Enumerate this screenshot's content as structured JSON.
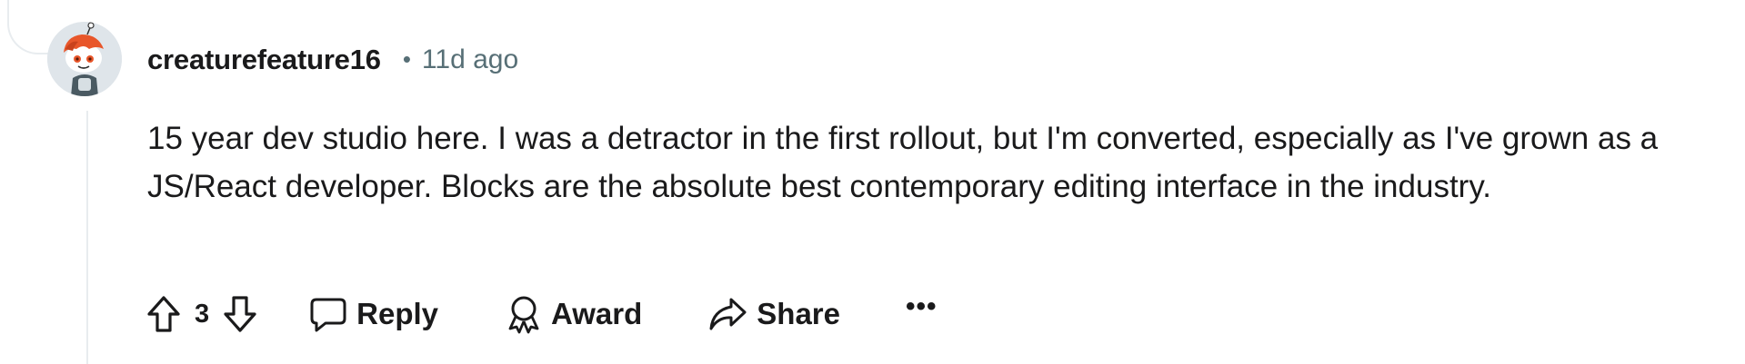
{
  "comment": {
    "username": "creaturefeature16",
    "separator": "•",
    "timestamp": "11d ago",
    "body": "15 year dev studio here. I was a detractor in the first rollout, but I'm converted, especially as I've grown as a JS/React developer. Blocks are the absolute best contemporary editing interface in the industry."
  },
  "actions": {
    "vote_count": "3",
    "reply_label": "Reply",
    "award_label": "Award",
    "share_label": "Share",
    "more_label": "•••"
  },
  "icons": {
    "upvote": "arrow-up-outline-icon",
    "downvote": "arrow-down-outline-icon",
    "reply": "speech-bubble-icon",
    "award": "award-ribbon-icon",
    "share": "share-arrow-icon",
    "more": "ellipsis-icon"
  },
  "colors": {
    "text_primary": "#1a1a1b",
    "text_secondary": "#576f76",
    "thread_line": "#e8ecef",
    "avatar_orange": "#e8562a"
  }
}
